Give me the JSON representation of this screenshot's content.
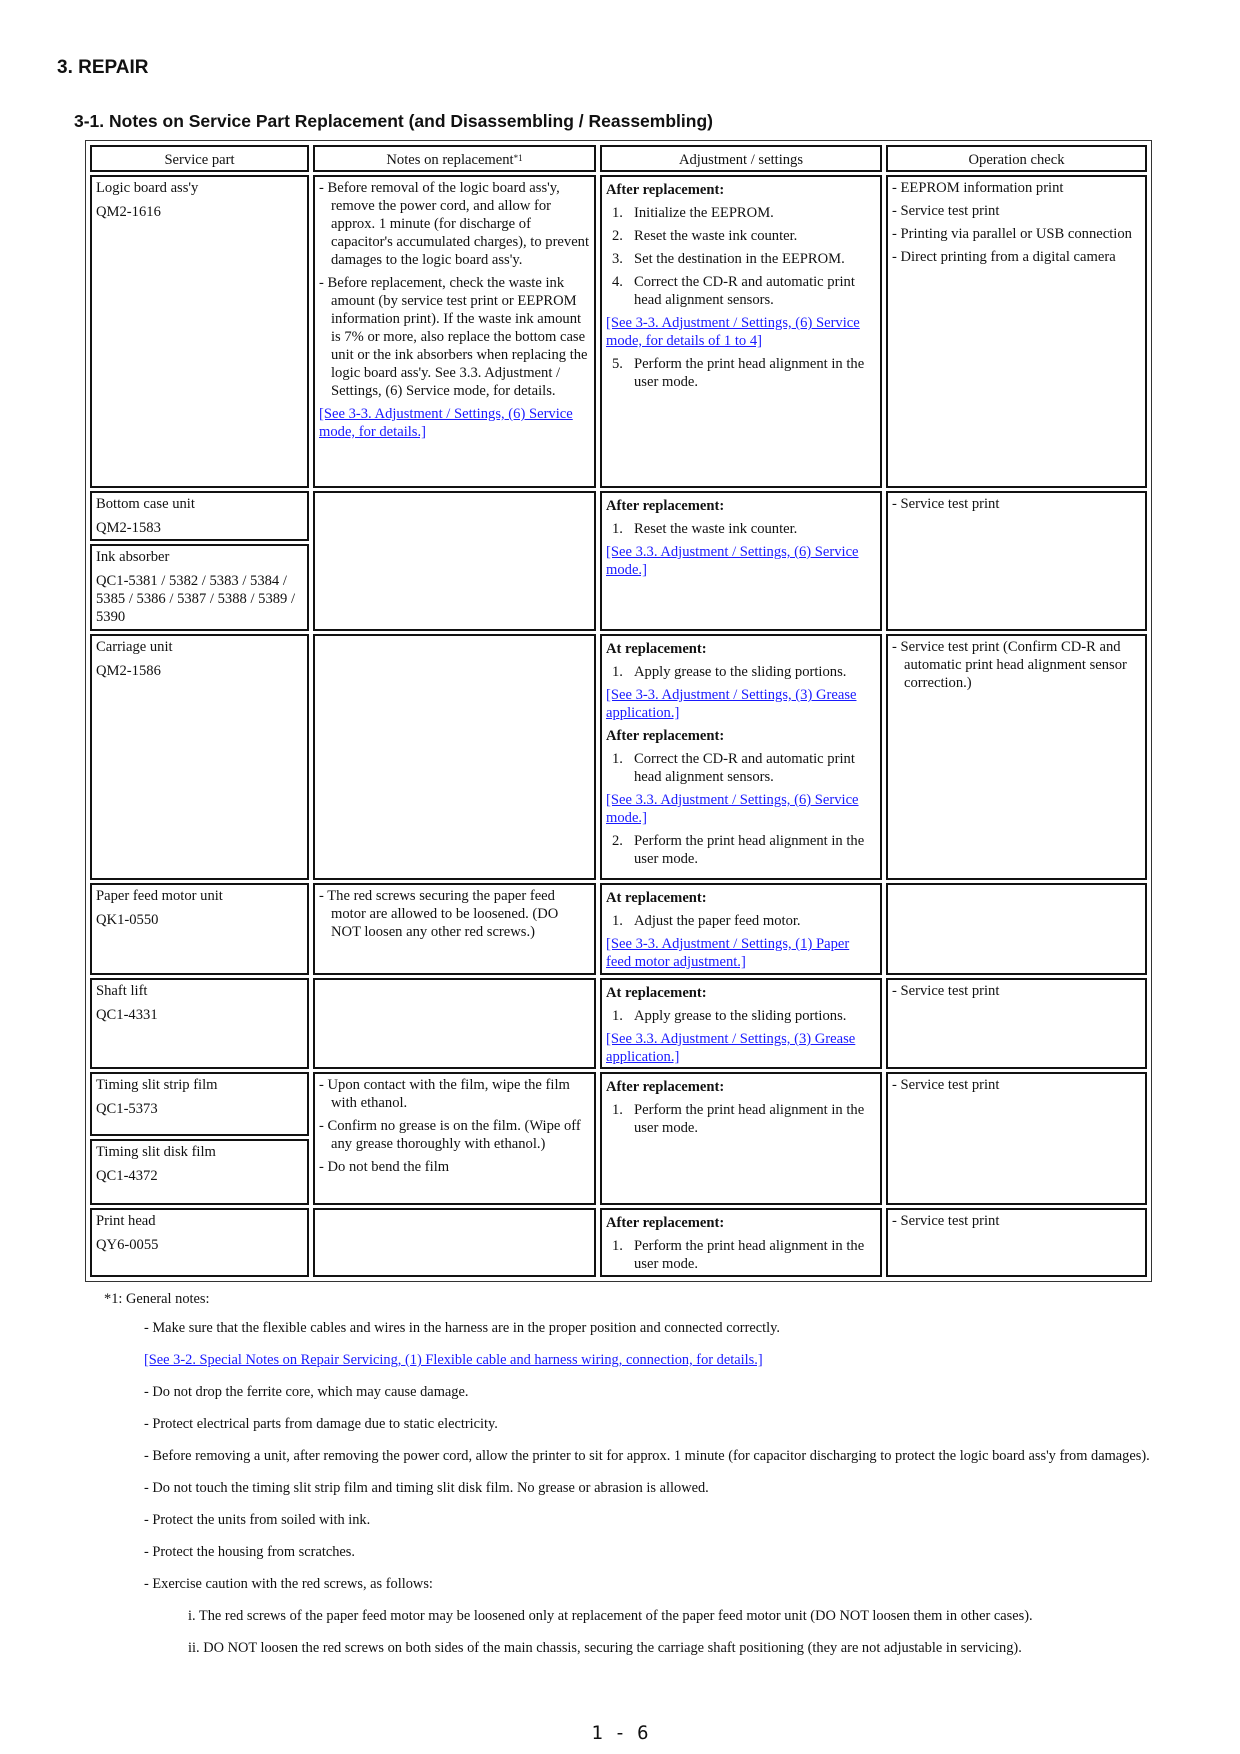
{
  "document": {
    "section_title": "3.  REPAIR",
    "subsection_title": "3-1.  Notes on Service Part Replacement (and Disassembling / Reassembling)",
    "page_number": "1 - 6"
  },
  "table": {
    "headers": {
      "service_part": "Service part",
      "notes": "Notes on replacement",
      "notes_sup": "*1",
      "adjustment": "Adjustment / settings",
      "operation": "Operation check"
    },
    "rows": [
      {
        "parts": [
          {
            "name": "Logic board ass'y",
            "code": "QM2-1616"
          }
        ],
        "notes": [
          "- Before removal of the logic board ass'y, remove the power cord, and allow for approx. 1 minute (for discharge of capacitor's accumulated charges), to prevent damages to the logic board ass'y.",
          "- Before replacement, check the waste ink amount (by service test print or EEPROM information print). If the waste ink amount is 7% or more, also replace the bottom case unit or the ink absorbers when replacing the logic board ass'y. See 3.3. Adjustment / Settings, (6) Service mode, for details."
        ],
        "notes_link": "[See 3-3. Adjustment / Settings, (6) Service mode, for details.]",
        "adjustment": {
          "heading": "After replacement:",
          "steps": [
            {
              "n": "1.",
              "text": "Initialize the EEPROM."
            },
            {
              "n": "2.",
              "text": "Reset the waste ink counter."
            },
            {
              "n": "3.",
              "text": "Set the destination in the EEPROM."
            },
            {
              "n": "4.",
              "text": "Correct the CD-R and automatic print head alignment sensors."
            }
          ],
          "link": "[See 3-3. Adjustment / Settings, (6) Service mode, for details of 1 to 4]",
          "steps_after": [
            {
              "n": "5.",
              "text": "Perform the print head alignment in the user mode."
            }
          ]
        },
        "operation": [
          "- EEPROM information print",
          "- Service test print",
          "- Printing via parallel or USB connection",
          "- Direct printing from a digital camera"
        ]
      },
      {
        "parts": [
          {
            "name": "Bottom case unit",
            "code": "QM2-1583"
          },
          {
            "name": "Ink absorber",
            "code": "QC1-5381 / 5382 / 5383 / 5384 / 5385 / 5386 / 5387 / 5388 / 5389 / 5390"
          }
        ],
        "adjustment": {
          "heading": "After replacement:",
          "steps": [
            {
              "n": "1.",
              "text": "Reset the waste ink counter."
            }
          ],
          "link": "[See 3.3. Adjustment / Settings, (6) Service mode.]"
        },
        "operation": [
          "- Service test print"
        ]
      },
      {
        "parts": [
          {
            "name": "Carriage unit",
            "code": "QM2-1586"
          }
        ],
        "adjustment": {
          "heading": "At replacement:",
          "steps": [
            {
              "n": "1.",
              "text": "Apply grease to the sliding portions."
            }
          ],
          "link": " [See 3-3. Adjustment / Settings, (3) Grease application.]",
          "heading2": "After replacement:",
          "steps2": [
            {
              "n": "1.",
              "text": "Correct the CD-R and automatic print head alignment sensors."
            }
          ],
          "link2": "[See 3.3. Adjustment / Settings, (6) Service mode.]",
          "steps3": [
            {
              "n": "2.",
              "text": "Perform the print head alignment in the user mode."
            }
          ]
        },
        "operation": [
          "- Service test print (Confirm CD-R and automatic print head alignment sensor correction.)"
        ]
      },
      {
        "parts": [
          {
            "name": "Paper feed motor unit",
            "code": "QK1-0550"
          }
        ],
        "notes": [
          "- The red screws securing the paper feed motor are allowed to be loosened. (DO NOT loosen any other red screws.)"
        ],
        "adjustment": {
          "heading": "At replacement:",
          "steps": [
            {
              "n": "1.",
              "text": "Adjust the paper feed motor."
            }
          ],
          "link": "[See 3-3. Adjustment / Settings, (1) Paper feed motor adjustment.]"
        }
      },
      {
        "parts": [
          {
            "name": "Shaft lift",
            "code": "QC1-4331"
          }
        ],
        "adjustment": {
          "heading": "At replacement:",
          "steps": [
            {
              "n": "1.",
              "text": "Apply grease to the sliding portions."
            }
          ],
          "link": "[See 3.3. Adjustment / Settings, (3) Grease application.]"
        },
        "operation": [
          "- Service test print"
        ]
      },
      {
        "parts": [
          {
            "name": "Timing slit strip film",
            "code": "QC1-5373"
          },
          {
            "name": "Timing slit disk film",
            "code": "QC1-4372"
          }
        ],
        "notes": [
          "- Upon contact with the film, wipe the film with ethanol.",
          "- Confirm no grease is on the film. (Wipe off any grease thoroughly with ethanol.)",
          "- Do not bend the film"
        ],
        "adjustment": {
          "heading": "After replacement:",
          "steps": [
            {
              "n": "1.",
              "text": "Perform the print head alignment in the user mode."
            }
          ]
        },
        "operation": [
          "- Service test print"
        ]
      },
      {
        "parts": [
          {
            "name": "Print head",
            "code": "QY6-0055"
          }
        ],
        "adjustment": {
          "heading": "After replacement:",
          "steps": [
            {
              "n": "1.",
              "text": "Perform the print head alignment in the user mode."
            }
          ]
        },
        "operation": [
          "- Service test print"
        ]
      }
    ]
  },
  "general_notes": {
    "heading": "*1:  General notes:",
    "item_0": "- Make sure that the flexible cables and wires in the harness are in the proper position and connected correctly.",
    "link_0": "[See 3-2. Special Notes on Repair Servicing, (1) Flexible cable and harness wiring, connection, for details.]",
    "item_1": "- Do not drop the ferrite core, which may cause damage.",
    "item_2": "- Protect electrical parts from damage due to static electricity.",
    "item_3": "- Before removing a unit, after removing the power cord, allow the printer to sit for approx. 1 minute (for capacitor discharging to protect the logic board ass'y from damages).",
    "item_4": "- Do not touch the timing slit strip film and timing slit disk film. No grease or abrasion is allowed.",
    "item_5": "- Protect the units from soiled with ink.",
    "item_6": "- Protect the housing from scratches.",
    "item_7": "- Exercise caution with the red screws, as follows:",
    "sub_0": "i.  The red screws of the paper feed motor may be loosened only at replacement of the paper feed motor unit (DO NOT loosen them in other cases).",
    "sub_1": "ii.  DO NOT loosen the red screws on both sides of the main chassis, securing the carriage shaft positioning (they are not adjustable in servicing)."
  },
  "colors": {
    "link": "#1a1aff",
    "text": "#111111",
    "border": "#111111"
  }
}
